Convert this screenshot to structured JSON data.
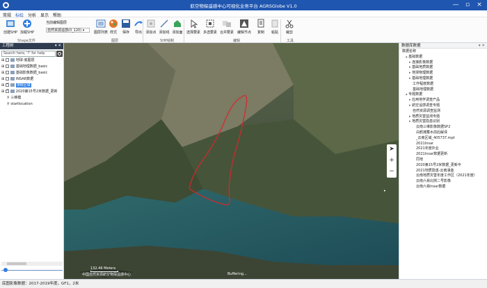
{
  "app": {
    "title": "航空物探遥感中心可视化业务平台 AGRSGlobe V1.0",
    "min": "—",
    "max": "▫",
    "close": "×"
  },
  "menu": [
    "常规",
    "标绘",
    "分析",
    "显示",
    "帮助"
  ],
  "ribbon": {
    "buttons": [
      {
        "label": "创建SHP",
        "icon": "create-shp-icon",
        "color": "#4a90d9"
      },
      {
        "label": "加载SHP",
        "icon": "load-shp-icon",
        "color": "#2f7de1"
      },
      {
        "label": "图层列表",
        "icon": "layer-list-icon",
        "color": "#3b6fb5"
      },
      {
        "label": "样式",
        "icon": "style-icon",
        "color": "#e0762b"
      },
      {
        "label": "保存",
        "icon": "save-icon",
        "color": "#2f5e9e"
      },
      {
        "label": "导出",
        "icon": "export-icon",
        "color": "#2f7de1"
      },
      {
        "label": "添加点",
        "icon": "add-point-icon",
        "color": "#b0b0b0"
      },
      {
        "label": "添加线",
        "icon": "add-line-icon",
        "color": "#5a7fb5"
      },
      {
        "label": "添加面",
        "icon": "add-polygon-icon",
        "color": "#3aa35a"
      },
      {
        "label": "选择要素",
        "icon": "select-feature-icon",
        "color": "#7a8aa0"
      },
      {
        "label": "多选要素",
        "icon": "multiselect-icon",
        "color": "#7a8aa0"
      },
      {
        "label": "合并要素",
        "icon": "merge-icon",
        "color": "#b0b0b0"
      },
      {
        "label": "编辑节点",
        "icon": "edit-node-icon",
        "color": "#555555"
      },
      {
        "label": "复制",
        "icon": "copy-icon",
        "color": "#7a8aa0"
      },
      {
        "label": "粘贴",
        "icon": "paste-icon",
        "color": "#b0b0b0"
      },
      {
        "label": "裁剪",
        "icon": "cut-icon",
        "color": "#444444"
      }
    ],
    "current_layer_label": "当前编辑图层",
    "current_layer_value": "自然资源遥感(0_120)",
    "groups": [
      "Shape文件",
      "图层",
      "SHP绘制",
      "编辑",
      "工具"
    ]
  },
  "left_panel": {
    "title": "工程树",
    "search_placeholder": "Search here, '?' for help",
    "tree": [
      {
        "label": "地球-底图层",
        "checked": false,
        "indent": 1
      },
      {
        "label": "基础地理数据_basic",
        "checked": false,
        "indent": 1
      },
      {
        "label": "基础影像数据_basic",
        "checked": false,
        "indent": 1
      },
      {
        "label": "INSAR数据",
        "checked": false,
        "indent": 1
      },
      {
        "label": "测绘区域",
        "checked": true,
        "indent": 1,
        "selected": true
      },
      {
        "label": "2020第15号2米数据_更新",
        "checked": true,
        "indent": 1
      },
      {
        "label": "三维模",
        "checked": false,
        "indent": 1
      },
      {
        "label": "startlocation",
        "checked": false,
        "indent": 1
      }
    ]
  },
  "map": {
    "scale_label": "132.46 Meters",
    "credit": "中国自然资源航空物探遥感中心",
    "buffering": "Buffering...",
    "zoom_in": "+",
    "zoom_out": "−",
    "collapse_arrow": "▸"
  },
  "right_panel": {
    "title": "数据库数据",
    "root": "数据名称",
    "items": [
      {
        "label": "基础数据",
        "type": "grp",
        "indent": 1
      },
      {
        "label": "连接影像数据",
        "type": "sub",
        "indent": 2
      },
      {
        "label": "基础地质数据",
        "type": "sub",
        "indent": 2
      },
      {
        "label": "地球物理数据",
        "type": "sub",
        "indent": 2
      },
      {
        "label": "基础地理数据",
        "type": "sub",
        "indent": 2
      },
      {
        "label": "工作程度数据",
        "type": "item",
        "indent": 3
      },
      {
        "label": "基础地理数据",
        "type": "item",
        "indent": 3
      },
      {
        "label": "专题数据",
        "type": "grp",
        "indent": 1
      },
      {
        "label": "应用地学调查产品",
        "type": "sub",
        "indent": 2
      },
      {
        "label": "航空遥感调查专题",
        "type": "sub",
        "indent": 2
      },
      {
        "label": "自然资源调查监测",
        "type": "item",
        "indent": 3
      },
      {
        "label": "地质灾害监测专题",
        "type": "sub",
        "indent": 2
      },
      {
        "label": "地质灾害隐患识别",
        "type": "sub",
        "indent": 2
      },
      {
        "label": "云南三维影像数据SP2",
        "type": "item",
        "indent": 4
      },
      {
        "label": "白鹤滩蓄水前后解译",
        "type": "item",
        "indent": 4
      },
      {
        "label": "_云南区域_405737.mpt",
        "type": "item",
        "indent": 4
      },
      {
        "label": "2021Insar",
        "type": "item",
        "indent": 4
      },
      {
        "label": "2021年度外业",
        "type": "item",
        "indent": 4
      },
      {
        "label": "2021Insar数据更新",
        "type": "item",
        "indent": 4
      },
      {
        "label": "同地",
        "type": "item",
        "indent": 4
      },
      {
        "label": "2020第15号2米数据_更新中",
        "type": "item",
        "indent": 4
      },
      {
        "label": "2021地质隐患-云南滇金",
        "type": "item",
        "indent": 4
      },
      {
        "label": "云南地质灾害年度工作区（2021年度）",
        "type": "item",
        "indent": 4
      },
      {
        "label": "云南六易北侧二号影像",
        "type": "item",
        "indent": 4
      },
      {
        "label": "云南六易Insar数据",
        "type": "item",
        "indent": 4
      }
    ]
  },
  "status": {
    "text": "底图影像数据：2017-2019年度，GF1，2米"
  }
}
